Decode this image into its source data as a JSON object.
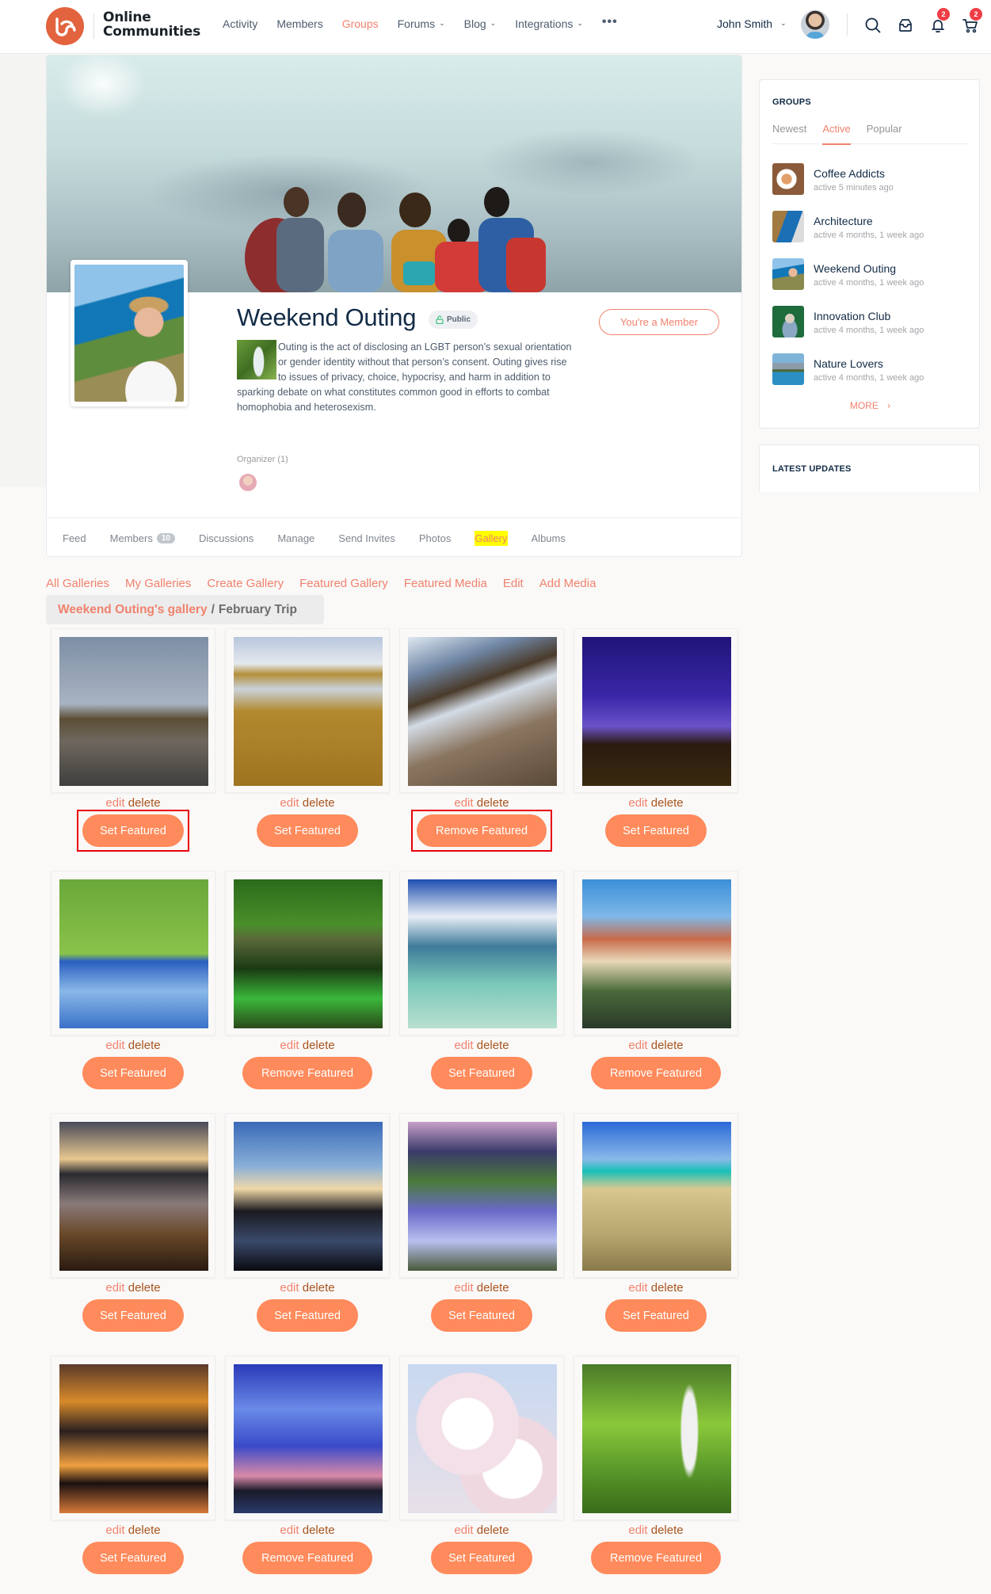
{
  "header": {
    "brand": [
      "Online",
      "Communities"
    ],
    "nav": [
      {
        "label": "Activity",
        "dropdown": false,
        "active": false
      },
      {
        "label": "Members",
        "dropdown": false,
        "active": false
      },
      {
        "label": "Groups",
        "dropdown": false,
        "active": true
      },
      {
        "label": "Forums",
        "dropdown": true,
        "active": false
      },
      {
        "label": "Blog",
        "dropdown": true,
        "active": false
      },
      {
        "label": "Integrations",
        "dropdown": true,
        "active": false
      }
    ],
    "more_label": "•••",
    "user_name": "John Smith",
    "notifications_count": "2",
    "cart_count": "2",
    "icons": [
      "search-icon",
      "inbox-icon",
      "bell-icon",
      "cart-icon"
    ]
  },
  "group": {
    "title": "Weekend Outing",
    "privacy": "Public",
    "member_button": "You're a Member",
    "description": "Outing is the act of disclosing an LGBT person’s sexual orientation or gender identity without that person’s consent. Outing gives rise to issues of privacy, choice, hypocrisy, and harm in addition to sparking debate on what constitutes common good in efforts to combat homophobia and heterosexism.",
    "organizer_label": "Organizer (1)",
    "tabs": [
      {
        "label": "Feed"
      },
      {
        "label": "Members",
        "count": "10"
      },
      {
        "label": "Discussions"
      },
      {
        "label": "Manage"
      },
      {
        "label": "Send Invites"
      },
      {
        "label": "Photos"
      },
      {
        "label": "Gallery",
        "active": true
      },
      {
        "label": "Albums"
      }
    ]
  },
  "gallery": {
    "nav": [
      "All Galleries",
      "My Galleries",
      "Create Gallery",
      "Featured Gallery",
      "Featured Media",
      "Edit",
      "Add Media"
    ],
    "breadcrumb": {
      "parent": "Weekend Outing's gallery",
      "separator": "/",
      "current": "February Trip"
    },
    "edit_label": "edit",
    "delete_label": "delete",
    "set_label": "Set Featured",
    "remove_label": "Remove Featured",
    "items": [
      {
        "subject": "rainbow over sea arch",
        "featured": false,
        "highlighted": true
      },
      {
        "subject": "sandy tidal flats",
        "featured": false,
        "highlighted": false
      },
      {
        "subject": "rocky coast at sunset",
        "featured": true,
        "highlighted": true
      },
      {
        "subject": "lightning over Uluru",
        "featured": false,
        "highlighted": false
      },
      {
        "subject": "leaf touching water",
        "featured": false,
        "highlighted": false
      },
      {
        "subject": "mossy stone bridge",
        "featured": true,
        "highlighted": false
      },
      {
        "subject": "boat on clear water",
        "featured": false,
        "highlighted": false
      },
      {
        "subject": "riverside town",
        "featured": true,
        "highlighted": false
      },
      {
        "subject": "sunset over sand ripples",
        "featured": false,
        "highlighted": false
      },
      {
        "subject": "cloud reflection on lake",
        "featured": false,
        "highlighted": false
      },
      {
        "subject": "mountain stream",
        "featured": false,
        "highlighted": false
      },
      {
        "subject": "sand ripples and turquoise sea",
        "featured": false,
        "highlighted": false
      },
      {
        "subject": "elephant at sunset",
        "featured": false,
        "highlighted": false
      },
      {
        "subject": "blue cloudy sky",
        "featured": true,
        "highlighted": false
      },
      {
        "subject": "cherry blossoms",
        "featured": false,
        "highlighted": false
      },
      {
        "subject": "forest waterfall",
        "featured": true,
        "highlighted": false
      }
    ]
  },
  "sidebar": {
    "groups_widget": {
      "title": "GROUPS",
      "tabs": [
        {
          "label": "Newest"
        },
        {
          "label": "Active",
          "active": true
        },
        {
          "label": "Popular"
        }
      ],
      "items": [
        {
          "name": "Coffee Addicts",
          "meta": "active 5 minutes ago"
        },
        {
          "name": "Architecture",
          "meta": "active 4 months, 1 week ago"
        },
        {
          "name": "Weekend Outing",
          "meta": "active 4 months, 1 week ago"
        },
        {
          "name": "Innovation Club",
          "meta": "active 4 months, 1 week ago"
        },
        {
          "name": "Nature Lovers",
          "meta": "active 4 months, 1 week ago"
        }
      ],
      "more_label": "MORE"
    },
    "updates_widget": {
      "title": "LATEST UPDATES"
    }
  },
  "colors": {
    "accent": "#f0826d",
    "button": "#ff8a5b",
    "highlight_box": "#e8000b",
    "badge": "#ef3e46",
    "tab_highlight": "#ffff00"
  }
}
